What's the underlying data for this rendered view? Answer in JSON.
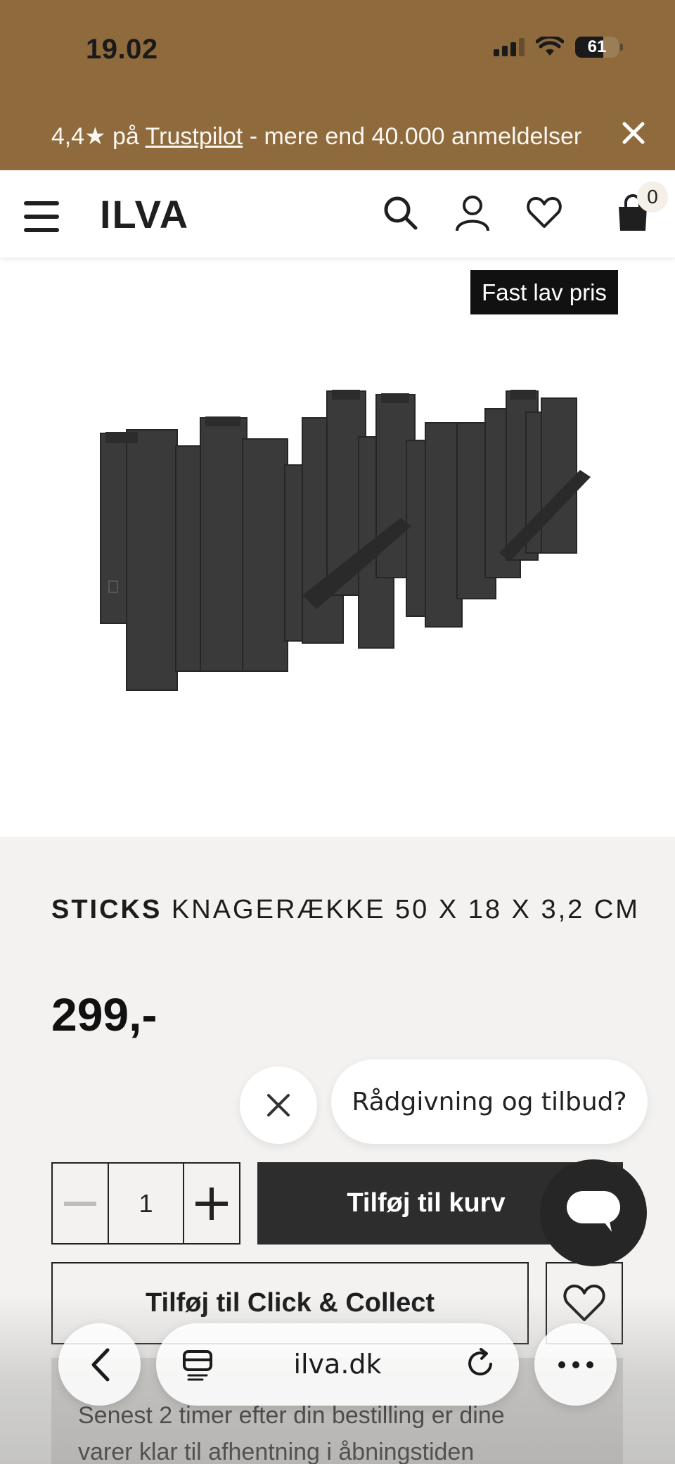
{
  "status_bar": {
    "time": "19.02",
    "battery": "61"
  },
  "trust_banner": {
    "rating": "4,4★ på",
    "link": "Trustpilot",
    "text": "- mere end 40.000 anmeldelser",
    "close_icon": "close-icon"
  },
  "header": {
    "logo": "ILVA",
    "icons": [
      "menu-icon",
      "search-icon",
      "account-icon",
      "heart-icon",
      "cart-icon"
    ],
    "cart_count": "0"
  },
  "product": {
    "badge": "Fast lav pris",
    "brand": "STICKS",
    "name": "KNAGERÆKKE 50 X 18 X 3,2 CM",
    "price": "299,-",
    "quantity": "1",
    "add_to_cart": "Tilføj til kurv",
    "click_collect": "Tilføj til Click & Collect",
    "info_line1": "Senest 2 timer efter din bestilling er dine",
    "info_line2": "varer klar til afhentning i åbningstiden"
  },
  "chat": {
    "prompt": "Rådgivning og tilbud?"
  },
  "browser": {
    "url": "ilva.dk"
  },
  "colors": {
    "brand_brown": "#8e6a3d",
    "dark_button": "#2d2d2d"
  }
}
